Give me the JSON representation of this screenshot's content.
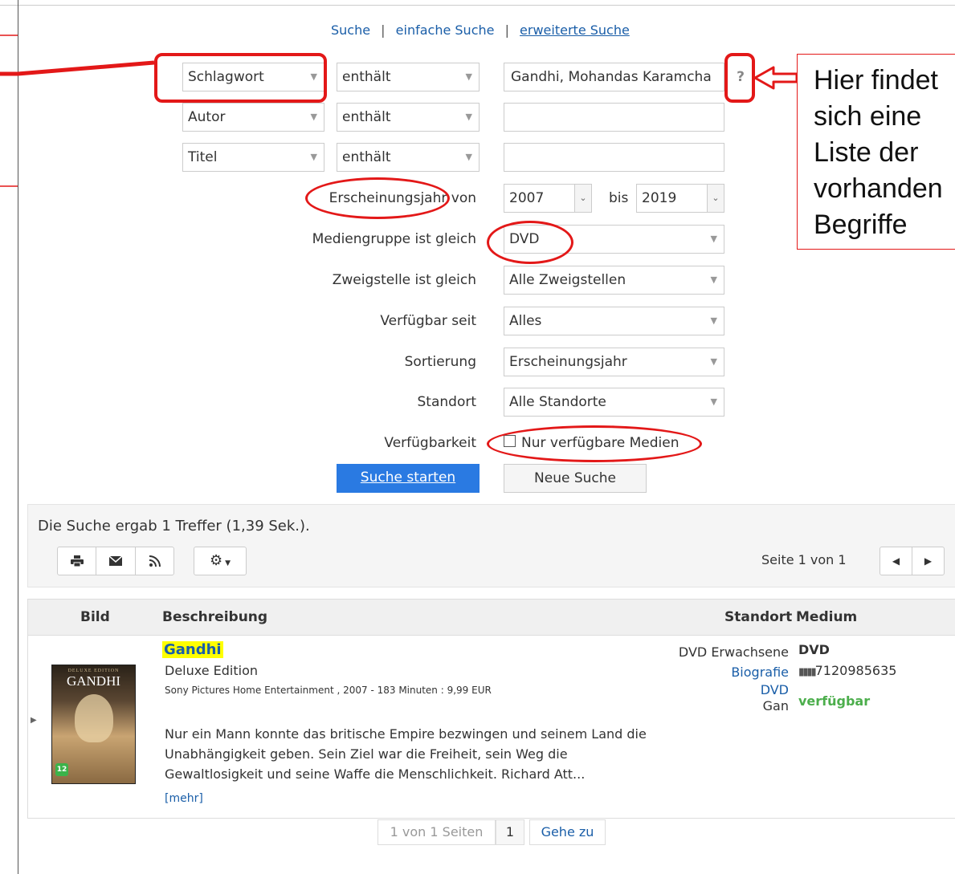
{
  "nav": {
    "suche": "Suche",
    "sep": "|",
    "einfach": "einfache Suche",
    "erweitert": "erweiterte Suche"
  },
  "rows": [
    {
      "field": "Schlagwort",
      "op": "enthält",
      "value": "Gandhi, Mohandas Karamcha"
    },
    {
      "field": "Autor",
      "op": "enthält",
      "value": ""
    },
    {
      "field": "Titel",
      "op": "enthält",
      "value": ""
    }
  ],
  "help": "?",
  "year": {
    "label": "Erscheinungsjahr von",
    "from": "2007",
    "bis": "bis",
    "to": "2019"
  },
  "filters": [
    {
      "label": "Mediengruppe ist gleich",
      "value": "DVD"
    },
    {
      "label": "Zweigstelle ist gleich",
      "value": "Alle Zweigstellen"
    },
    {
      "label": "Verfügbar seit",
      "value": "Alles"
    },
    {
      "label": "Sortierung",
      "value": "Erscheinungsjahr"
    },
    {
      "label": "Standort",
      "value": "Alle Standorte"
    }
  ],
  "availability": {
    "label": "Verfügbarkeit",
    "checkbox": "Nur verfügbare Medien"
  },
  "buttons": {
    "start": "Suche starten",
    "reset": "Neue Suche"
  },
  "callout": {
    "text": "Hier findet sich eine Liste der vorhanden Begriffe"
  },
  "results": {
    "summary": "Die Suche ergab 1 Treffer (1,39 Sek.).",
    "page": "Seite 1 von 1"
  },
  "table": {
    "headers": {
      "bild": "Bild",
      "beschreibung": "Beschreibung",
      "standort": "Standort",
      "medium": "Medium"
    },
    "item": {
      "title": "Gandhi",
      "subtitle": "Deluxe Edition",
      "publisher": "Sony Pictures Home Entertainment , 2007 - 183 Minuten : 9,99 EUR",
      "description": "Nur ein Mann konnte das britische Empire bezwingen und seinem Land die Unabhängigkeit geben. Sein Ziel war die Freiheit, sein Weg die Gewaltlosigkeit und seine Waffe die Menschlichkeit. Richard Att...",
      "more": "[mehr]",
      "standort1": "DVD Erwachsene",
      "standort2": "Biografie",
      "standort3": "DVD",
      "standort4": "Gan",
      "medium": "DVD",
      "barcode": "7120985635",
      "status": "verfügbar",
      "cover_title": "GANDHI",
      "cover_edition": "DELUXE EDITION",
      "cover_age": "12"
    }
  },
  "pager": {
    "pages": "1 von 1 Seiten",
    "current": "1",
    "goto": "Gehe zu"
  },
  "colors": {
    "accent": "#1a73e8",
    "annotation": "#e31818",
    "available": "#4cae4c",
    "highlight": "#ffff00"
  }
}
